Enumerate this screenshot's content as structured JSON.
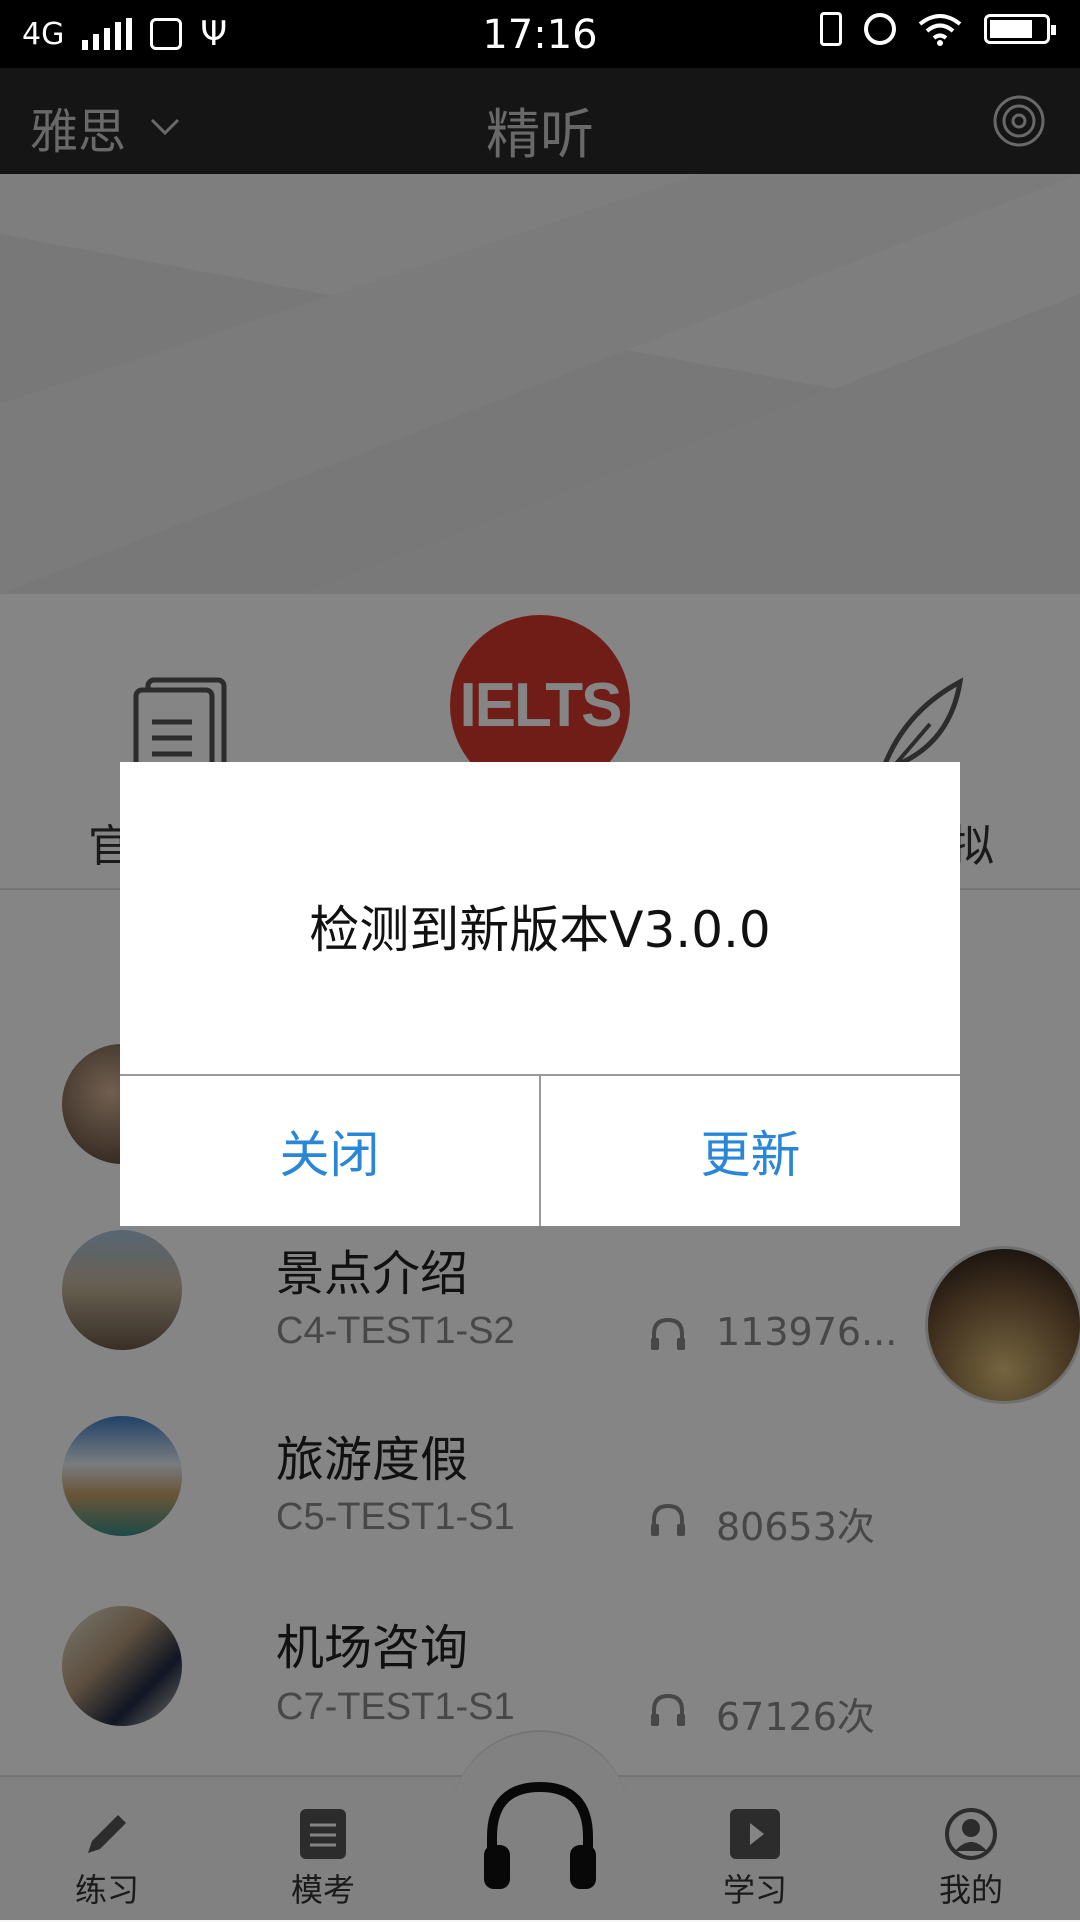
{
  "status_bar": {
    "network": "4G",
    "time": "17:16"
  },
  "app_bar": {
    "course": "雅思",
    "title": "精听"
  },
  "categories": {
    "center_logo": "IELTS",
    "left_label": "官",
    "right_label": "拟"
  },
  "list": [
    {
      "name": "景点介绍",
      "code": "C4-TEST1-S2",
      "plays": "113976..."
    },
    {
      "name": "旅游度假",
      "code": "C5-TEST1-S1",
      "plays": "80653次"
    },
    {
      "name": "机场咨询",
      "code": "C7-TEST1-S1",
      "plays": "67126次"
    }
  ],
  "bottom_nav": {
    "practice": "练习",
    "mock": "模考",
    "study": "学习",
    "mine": "我的"
  },
  "dialog": {
    "message": "检测到新版本V3.0.0",
    "close": "关闭",
    "update": "更新"
  },
  "colors": {
    "accent": "#2a87d8",
    "ielts_red": "#d8382c",
    "app_bar": "#292929"
  }
}
